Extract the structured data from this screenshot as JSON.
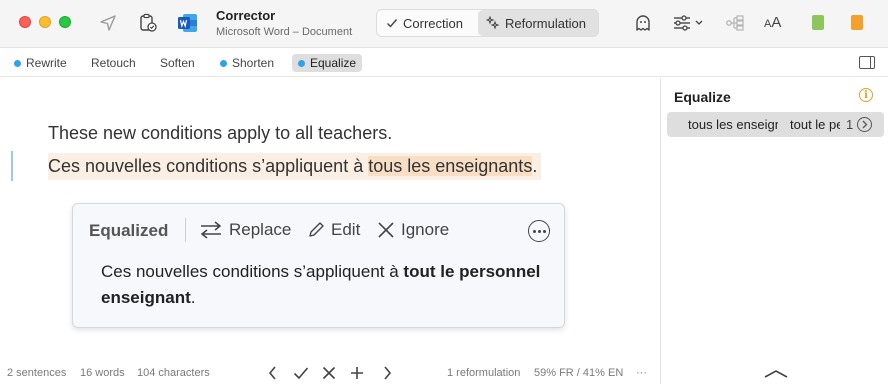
{
  "app": {
    "name": "Corrector",
    "document": "Microsoft Word – Document"
  },
  "toolbar": {
    "correction_label": "Correction",
    "reformulation_label": "Reformulation",
    "font_size_label_big": "A",
    "font_size_label_small": "A",
    "swatch_green": "#8dc65a",
    "swatch_orange": "#f2a12c"
  },
  "modes": [
    {
      "label": "Rewrite",
      "dot": true
    },
    {
      "label": "Retouch",
      "dot": false
    },
    {
      "label": "Soften",
      "dot": false
    },
    {
      "label": "Shorten",
      "dot": true
    },
    {
      "label": "Equalize",
      "dot": true,
      "active": true
    }
  ],
  "editor": {
    "source_sentence": "These new conditions apply to all teachers.",
    "target_prefix": "Ces nouvelles conditions s’appliquent à ",
    "target_highlight": "tous les enseignants",
    "target_suffix": "."
  },
  "popover": {
    "title": "Equalized",
    "replace_label": "Replace",
    "edit_label": "Edit",
    "ignore_label": "Ignore",
    "suggestion_prefix": "Ces nouvelles conditions s’appliquent à ",
    "suggestion_bold": "tout le personnel enseignant",
    "suggestion_suffix": "."
  },
  "status": {
    "sentences": "2 sentences",
    "words": "16 words",
    "characters": "104 characters",
    "reformulations": "1 reformulation",
    "language_mix": "59% FR / 41% EN",
    "more": "···"
  },
  "panel": {
    "title": "Equalize",
    "info": "i",
    "row": {
      "original": "tous les enseignants",
      "replacement": "tout le personnel enseignant",
      "count": "1"
    }
  },
  "colors": {
    "accent_dot": "#2fa3e6",
    "highlight": "#f9dec6",
    "sentence_bg": "#fbeee2"
  }
}
